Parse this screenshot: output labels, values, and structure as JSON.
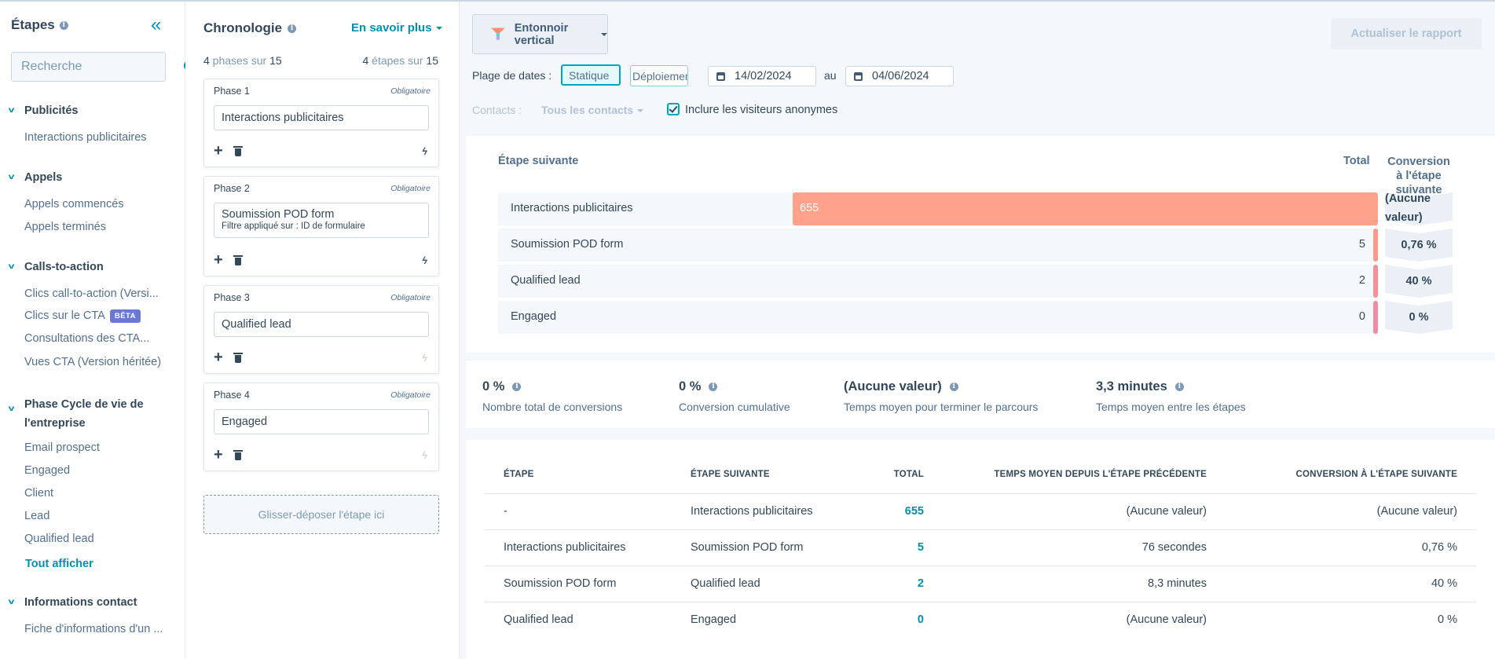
{
  "sidebar": {
    "title": "Étapes",
    "search_placeholder": "Recherche",
    "sections": [
      {
        "title": "Publicités",
        "items": [
          "Interactions publicitaires"
        ]
      },
      {
        "title": "Appels",
        "items": [
          "Appels commencés",
          "Appels terminés"
        ]
      },
      {
        "title": "Calls-to-action",
        "items": [
          "Clics call-to-action (Versi...",
          "Clics sur le CTA",
          "Consultations des CTA...",
          "Vues CTA (Version héritée)"
        ],
        "badge": "BÊTA"
      },
      {
        "title_line1": "Phase Cycle de vie de",
        "title_line2": "l'entreprise",
        "items": [
          "Email prospect",
          "Engaged",
          "Client",
          "Lead",
          "Qualified lead"
        ],
        "show_all": "Tout afficher"
      },
      {
        "title": "Informations contact",
        "items": [
          "Fiche d'informations d'un ..."
        ]
      }
    ]
  },
  "timeline": {
    "title": "Chronologie",
    "learn_more": "En savoir plus",
    "phases_count": {
      "n": "4",
      "text": " phases sur ",
      "total": "15"
    },
    "steps_count": {
      "n": "4",
      "text": " étapes sur ",
      "total": "15"
    },
    "required_label": "Obligatoire",
    "phases": [
      {
        "label": "Phase 1",
        "name": "Interactions publicitaires",
        "filter": null,
        "bolt_active": true
      },
      {
        "label": "Phase 2",
        "name": "Soumission POD form",
        "filter": "Filtre appliqué sur : ID de formulaire",
        "bolt_active": true
      },
      {
        "label": "Phase 3",
        "name": "Qualified lead",
        "filter": null,
        "bolt_active": false
      },
      {
        "label": "Phase 4",
        "name": "Engaged",
        "filter": null,
        "bolt_active": false
      }
    ],
    "drop_zone": "Glisser-déposer l'étape ici"
  },
  "toolbar": {
    "viz_type": "Entonnoir vertical",
    "refresh": "Actualiser le rapport",
    "date_range_label": "Plage de dates :",
    "static": "Statique",
    "rolling": "Déploiement",
    "date_from": "14/02/2024",
    "to_label": "au",
    "date_to": "04/06/2024",
    "contacts_label": "Contacts :",
    "contacts_value": "Tous les contacts",
    "anon_label": "Inclure les visiteurs anonymes",
    "anon_checked": true
  },
  "chart_data": {
    "type": "bar",
    "title": "",
    "orientation": "horizontal-funnel",
    "headers": {
      "step": "Étape suivante",
      "total": "Total",
      "conversion": "Conversion à l'étape suivante"
    },
    "categories": [
      "Interactions publicitaires",
      "Soumission POD form",
      "Qualified lead",
      "Engaged"
    ],
    "values": [
      655,
      5,
      2,
      0
    ],
    "conversion": [
      "(Aucune valeur)",
      "0,76 %",
      "40 %",
      "0 %"
    ],
    "colors": [
      "#ffa28b",
      "#f99a8e",
      "#f5909a",
      "#ea8fa6"
    ],
    "xlim": [
      0,
      655
    ]
  },
  "stats": [
    {
      "value": "0 %",
      "label": "Nombre total de conversions"
    },
    {
      "value": "0 %",
      "label": "Conversion cumulative"
    },
    {
      "value": "(Aucune valeur)",
      "label": "Temps moyen pour terminer le parcours"
    },
    {
      "value": "3,3 minutes",
      "label": "Temps moyen entre les étapes"
    }
  ],
  "table": {
    "headers": [
      "Étape",
      "Étape suivante",
      "Total",
      "Temps moyen depuis l'étape précédente",
      "Conversion à l'étape suivante"
    ],
    "rows": [
      [
        "-",
        "Interactions publicitaires",
        "655",
        "(Aucune valeur)",
        "(Aucune valeur)"
      ],
      [
        "Interactions publicitaires",
        "Soumission POD form",
        "5",
        "76 secondes",
        "0,76 %"
      ],
      [
        "Soumission POD form",
        "Qualified lead",
        "2",
        "8,3 minutes",
        "40 %"
      ],
      [
        "Qualified lead",
        "Engaged",
        "0",
        "(Aucune valeur)",
        "0 %"
      ]
    ]
  }
}
